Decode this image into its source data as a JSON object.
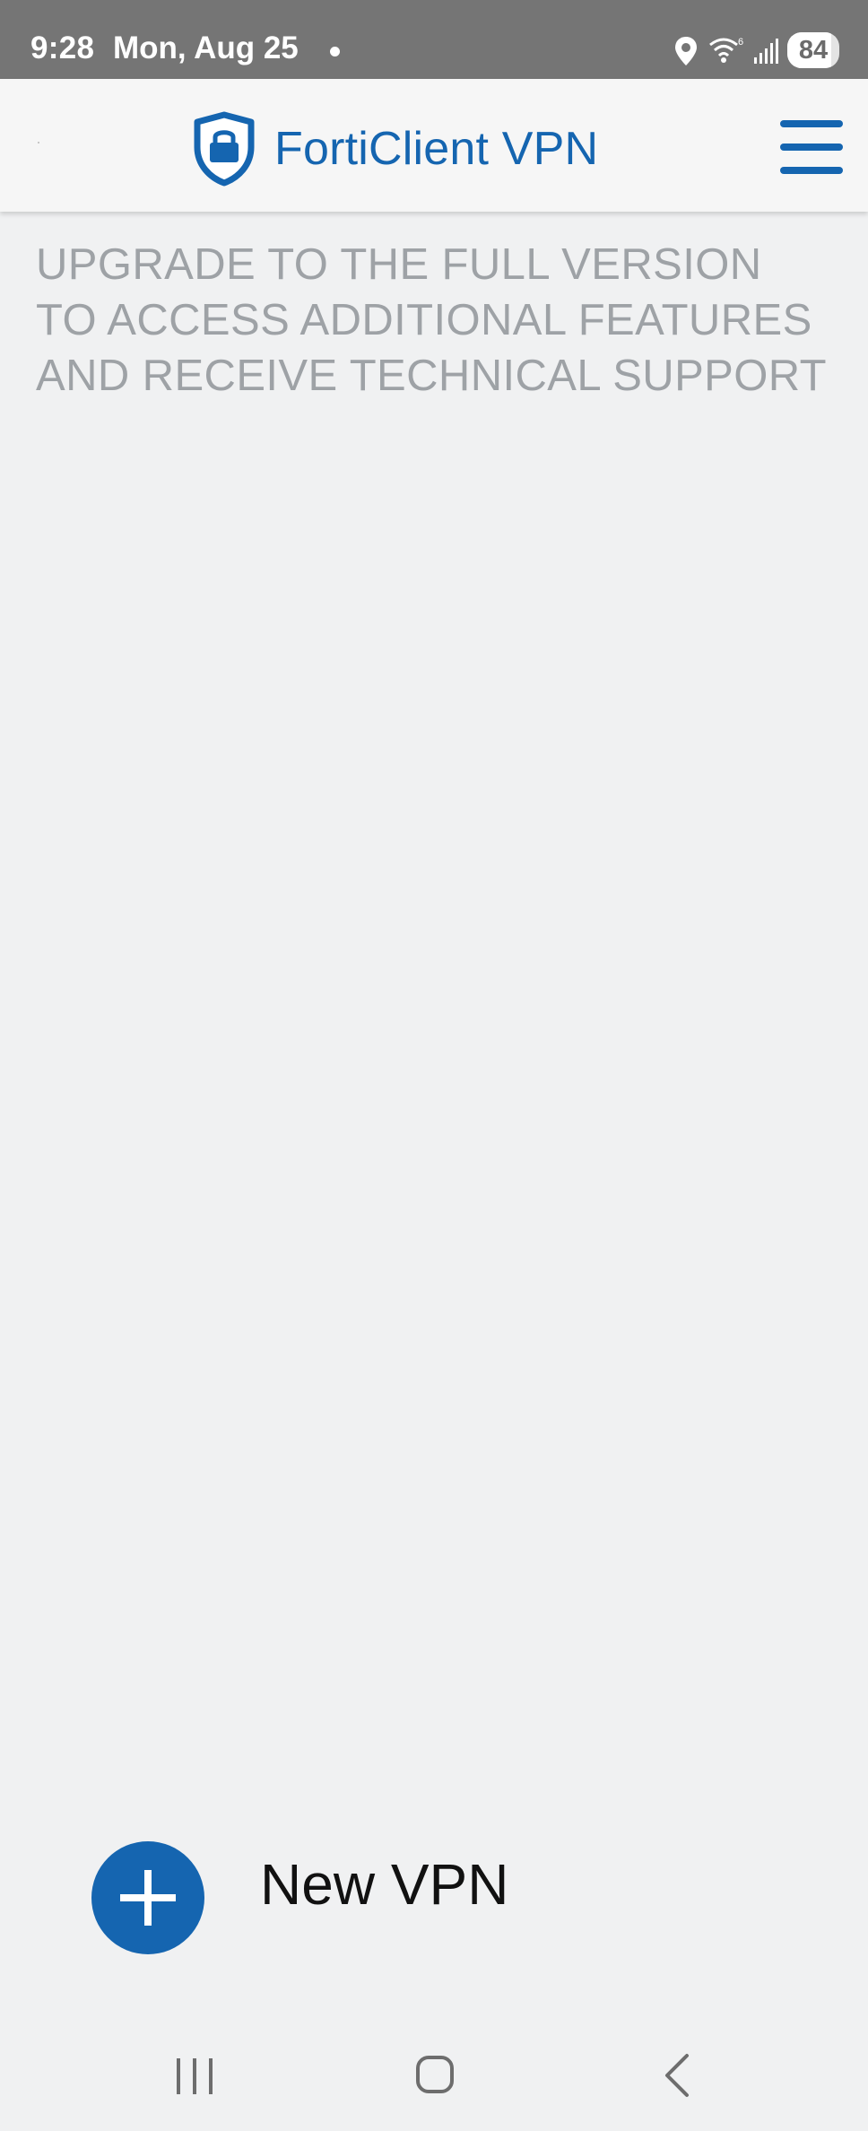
{
  "status_bar": {
    "time": "9:28",
    "date": "Mon, Aug 25",
    "battery_level": "84",
    "icons": [
      "location-icon",
      "wifi-icon",
      "signal-icon",
      "battery-icon"
    ]
  },
  "app_bar": {
    "title": "FortiClient VPN",
    "logo_icon": "shield-lock-icon",
    "menu_icon": "hamburger-menu-icon"
  },
  "banner": {
    "lines": [
      "UPGRADE TO THE FULL VERSION",
      "TO ACCESS ADDITIONAL FEATURES",
      "AND RECEIVE TECHNICAL SUPPORT"
    ]
  },
  "fab": {
    "icon": "plus-icon",
    "label": "New VPN"
  },
  "nav_bar": {
    "buttons": [
      "recents-icon",
      "home-icon",
      "back-icon"
    ]
  },
  "colors": {
    "accent": "#1565b0",
    "status_bar": "#757575",
    "background": "#f0f1f2",
    "banner_text": "#9ea2a6"
  }
}
